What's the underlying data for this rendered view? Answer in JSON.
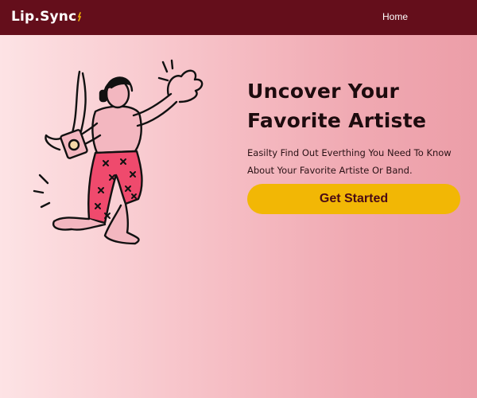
{
  "nav": {
    "logo_text": "Lip.Sync",
    "logo_mark_icon": "music-note-icon",
    "home_label": "Home"
  },
  "hero": {
    "title": "Uncover Your Favorite Artiste",
    "subtitle": "Easilty Find Out Everthing You Need To Know About Your Favorite Artiste Or Band.",
    "cta_label": "Get Started",
    "illustration": "dancing-person-with-headphones-illustration"
  },
  "colors": {
    "navbar": "#640e1b",
    "cta": "#f2b705",
    "pants": "#ef4a6d",
    "background_start": "#fde3e5",
    "background_end": "#ec9ea8"
  }
}
